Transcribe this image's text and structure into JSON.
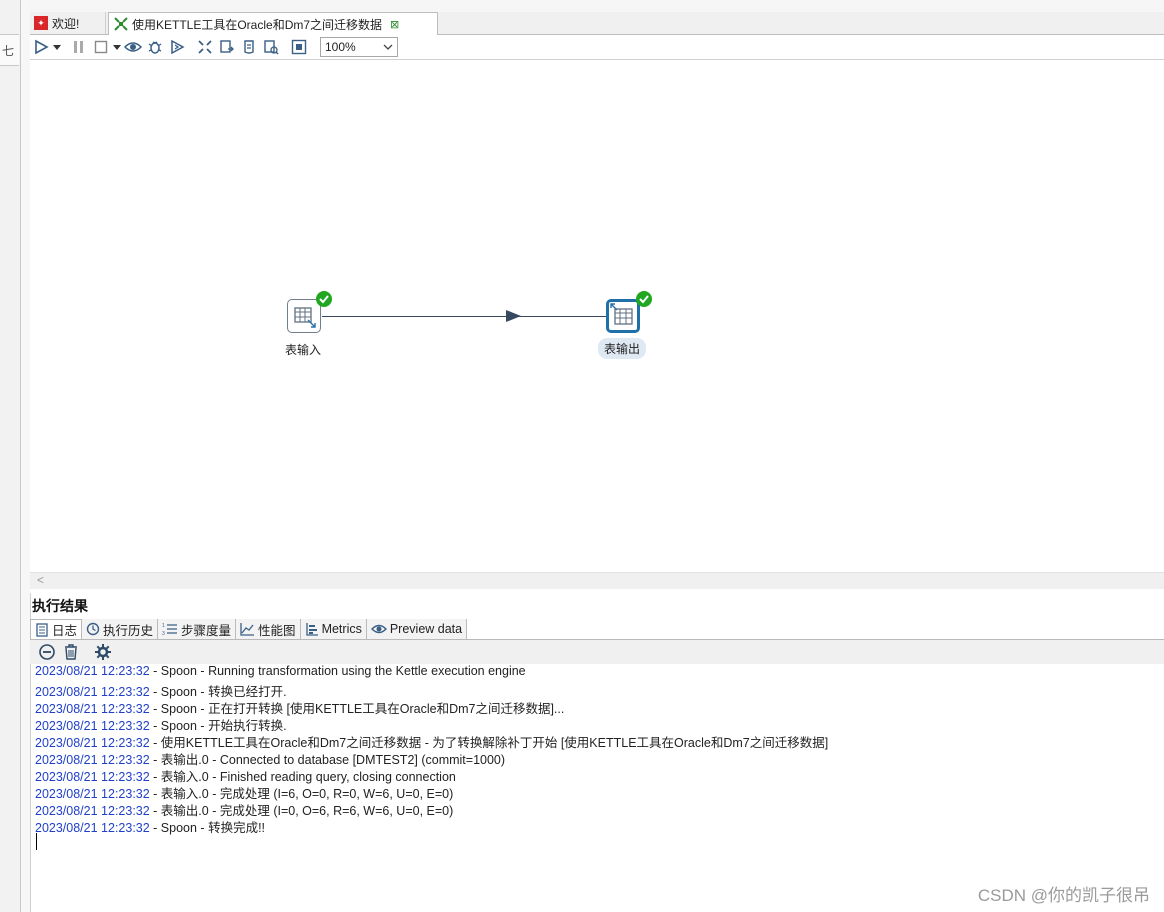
{
  "left_panel": {
    "glyph": "七"
  },
  "tabs": [
    {
      "label": "欢迎!",
      "icon": "welcome-icon"
    },
    {
      "label": "使用KETTLE工具在Oracle和Dm7之间迁移数据",
      "icon": "transformation-icon",
      "close": "⊠"
    }
  ],
  "toolbar": {
    "zoom_value": "100%",
    "icons": [
      "run-icon",
      "run-options-icon",
      "pause-icon",
      "stop-icon",
      "stop-options-icon",
      "preview-icon",
      "debug-icon",
      "replay-icon",
      "verify-icon",
      "impact-icon",
      "sql-icon",
      "explore-db-icon",
      "layout-icon"
    ]
  },
  "canvas": {
    "steps": [
      {
        "label": "表输入",
        "status": "success",
        "selected": false
      },
      {
        "label": "表输出",
        "status": "success",
        "selected": true
      }
    ],
    "hop_color": "#36495f",
    "scroll_arrow": "<"
  },
  "results": {
    "title": "执行结果",
    "tabs": [
      {
        "label": "日志",
        "icon": "log-icon",
        "active": true
      },
      {
        "label": "执行历史",
        "icon": "history-icon",
        "active": false
      },
      {
        "label": "步骤度量",
        "icon": "step-metrics-icon",
        "active": false
      },
      {
        "label": "性能图",
        "icon": "performance-graph-icon",
        "active": false
      },
      {
        "label": "Metrics",
        "icon": "metrics-icon",
        "active": false
      },
      {
        "label": "Preview data",
        "icon": "preview-data-icon",
        "active": false
      }
    ],
    "log_tools": [
      "clear-log-icon",
      "delete-log-icon",
      "log-settings-icon"
    ],
    "log_lines": [
      {
        "ts": "2023/08/21 12:23:32",
        "msg": " - Spoon - Running transformation using the Kettle execution engine"
      },
      {
        "ts": "2023/08/21 12:23:32",
        "msg": " - Spoon - 转换已经打开."
      },
      {
        "ts": "2023/08/21 12:23:32",
        "msg": " - Spoon - 正在打开转换 [使用KETTLE工具在Oracle和Dm7之间迁移数据]..."
      },
      {
        "ts": "2023/08/21 12:23:32",
        "msg": " - Spoon - 开始执行转换."
      },
      {
        "ts": "2023/08/21 12:23:32",
        "msg": " - 使用KETTLE工具在Oracle和Dm7之间迁移数据 - 为了转换解除补丁开始  [使用KETTLE工具在Oracle和Dm7之间迁移数据]"
      },
      {
        "ts": "2023/08/21 12:23:32",
        "msg": " - 表输出.0 - Connected to database [DMTEST2] (commit=1000)"
      },
      {
        "ts": "2023/08/21 12:23:32",
        "msg": " - 表输入.0 - Finished reading query, closing connection"
      },
      {
        "ts": "2023/08/21 12:23:32",
        "msg": " - 表输入.0 - 完成处理 (I=6, O=0, R=0, W=6, U=0, E=0)"
      },
      {
        "ts": "2023/08/21 12:23:32",
        "msg": " - 表输出.0 - 完成处理 (I=0, O=6, R=6, W=6, U=0, E=0)"
      },
      {
        "ts": "2023/08/21 12:23:32",
        "msg": " - Spoon - 转换完成!!"
      }
    ]
  },
  "watermark": "CSDN @你的凯子很吊"
}
